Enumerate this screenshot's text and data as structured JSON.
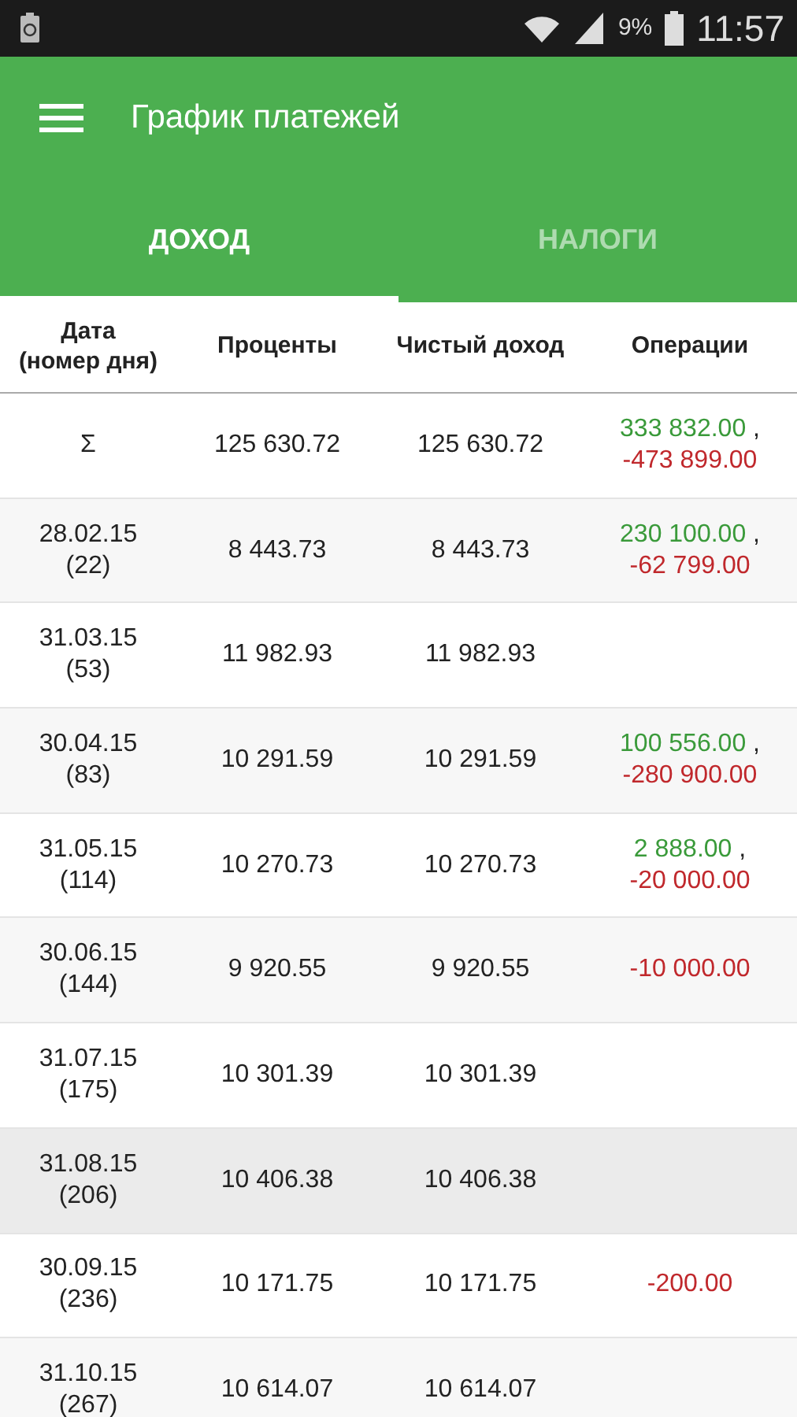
{
  "status_bar": {
    "battery_percent": "9%",
    "time": "11:57"
  },
  "app_bar": {
    "title": "График платежей"
  },
  "tabs": [
    {
      "label": "ДОХОД",
      "selected": true
    },
    {
      "label": "НАЛОГИ",
      "selected": false
    }
  ],
  "table": {
    "columns": [
      "Дата\n(номер дня)",
      "Проценты",
      "Чистый доход",
      "Операции"
    ],
    "rows": [
      {
        "date": "Σ",
        "interest": "125 630.72",
        "net": "125 630.72",
        "selected": false,
        "operations": [
          {
            "text": "333 832.00",
            "kind": "income",
            "separator": ","
          },
          {
            "text": "-473 899.00",
            "kind": "expense"
          }
        ]
      },
      {
        "date": "28.02.15\n(22)",
        "interest": "8 443.73",
        "net": "8 443.73",
        "selected": false,
        "operations": [
          {
            "text": "230 100.00",
            "kind": "income",
            "separator": ","
          },
          {
            "text": "-62 799.00",
            "kind": "expense"
          }
        ]
      },
      {
        "date": "31.03.15\n(53)",
        "interest": "11 982.93",
        "net": "11 982.93",
        "selected": false,
        "operations": []
      },
      {
        "date": "30.04.15\n(83)",
        "interest": "10 291.59",
        "net": "10 291.59",
        "selected": false,
        "operations": [
          {
            "text": "100 556.00",
            "kind": "income",
            "separator": ","
          },
          {
            "text": "-280 900.00",
            "kind": "expense"
          }
        ]
      },
      {
        "date": "31.05.15\n(114)",
        "interest": "10 270.73",
        "net": "10 270.73",
        "selected": false,
        "operations": [
          {
            "text": "2 888.00",
            "kind": "income",
            "separator": ","
          },
          {
            "text": "-20 000.00",
            "kind": "expense"
          }
        ]
      },
      {
        "date": "30.06.15\n(144)",
        "interest": "9 920.55",
        "net": "9 920.55",
        "selected": false,
        "operations": [
          {
            "text": "-10 000.00",
            "kind": "expense"
          }
        ]
      },
      {
        "date": "31.07.15\n(175)",
        "interest": "10 301.39",
        "net": "10 301.39",
        "selected": false,
        "operations": []
      },
      {
        "date": "31.08.15\n(206)",
        "interest": "10 406.38",
        "net": "10 406.38",
        "selected": true,
        "operations": []
      },
      {
        "date": "30.09.15\n(236)",
        "interest": "10 171.75",
        "net": "10 171.75",
        "selected": false,
        "operations": [
          {
            "text": "-200.00",
            "kind": "expense"
          }
        ]
      },
      {
        "date": "31.10.15\n(267)",
        "interest": "10 614.07",
        "net": "10 614.07",
        "selected": false,
        "operations": []
      }
    ]
  }
}
